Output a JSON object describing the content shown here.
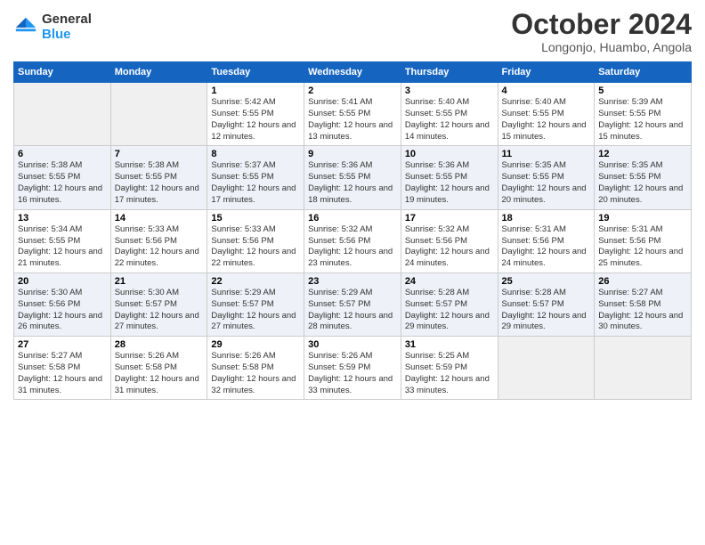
{
  "logo": {
    "general": "General",
    "blue": "Blue"
  },
  "title": "October 2024",
  "subtitle": "Longonjo, Huambo, Angola",
  "weekdays": [
    "Sunday",
    "Monday",
    "Tuesday",
    "Wednesday",
    "Thursday",
    "Friday",
    "Saturday"
  ],
  "weeks": [
    [
      {
        "day": "",
        "sunrise": "",
        "sunset": "",
        "daylight": ""
      },
      {
        "day": "",
        "sunrise": "",
        "sunset": "",
        "daylight": ""
      },
      {
        "day": "1",
        "sunrise": "Sunrise: 5:42 AM",
        "sunset": "Sunset: 5:55 PM",
        "daylight": "Daylight: 12 hours and 12 minutes."
      },
      {
        "day": "2",
        "sunrise": "Sunrise: 5:41 AM",
        "sunset": "Sunset: 5:55 PM",
        "daylight": "Daylight: 12 hours and 13 minutes."
      },
      {
        "day": "3",
        "sunrise": "Sunrise: 5:40 AM",
        "sunset": "Sunset: 5:55 PM",
        "daylight": "Daylight: 12 hours and 14 minutes."
      },
      {
        "day": "4",
        "sunrise": "Sunrise: 5:40 AM",
        "sunset": "Sunset: 5:55 PM",
        "daylight": "Daylight: 12 hours and 15 minutes."
      },
      {
        "day": "5",
        "sunrise": "Sunrise: 5:39 AM",
        "sunset": "Sunset: 5:55 PM",
        "daylight": "Daylight: 12 hours and 15 minutes."
      }
    ],
    [
      {
        "day": "6",
        "sunrise": "Sunrise: 5:38 AM",
        "sunset": "Sunset: 5:55 PM",
        "daylight": "Daylight: 12 hours and 16 minutes."
      },
      {
        "day": "7",
        "sunrise": "Sunrise: 5:38 AM",
        "sunset": "Sunset: 5:55 PM",
        "daylight": "Daylight: 12 hours and 17 minutes."
      },
      {
        "day": "8",
        "sunrise": "Sunrise: 5:37 AM",
        "sunset": "Sunset: 5:55 PM",
        "daylight": "Daylight: 12 hours and 17 minutes."
      },
      {
        "day": "9",
        "sunrise": "Sunrise: 5:36 AM",
        "sunset": "Sunset: 5:55 PM",
        "daylight": "Daylight: 12 hours and 18 minutes."
      },
      {
        "day": "10",
        "sunrise": "Sunrise: 5:36 AM",
        "sunset": "Sunset: 5:55 PM",
        "daylight": "Daylight: 12 hours and 19 minutes."
      },
      {
        "day": "11",
        "sunrise": "Sunrise: 5:35 AM",
        "sunset": "Sunset: 5:55 PM",
        "daylight": "Daylight: 12 hours and 20 minutes."
      },
      {
        "day": "12",
        "sunrise": "Sunrise: 5:35 AM",
        "sunset": "Sunset: 5:55 PM",
        "daylight": "Daylight: 12 hours and 20 minutes."
      }
    ],
    [
      {
        "day": "13",
        "sunrise": "Sunrise: 5:34 AM",
        "sunset": "Sunset: 5:55 PM",
        "daylight": "Daylight: 12 hours and 21 minutes."
      },
      {
        "day": "14",
        "sunrise": "Sunrise: 5:33 AM",
        "sunset": "Sunset: 5:56 PM",
        "daylight": "Daylight: 12 hours and 22 minutes."
      },
      {
        "day": "15",
        "sunrise": "Sunrise: 5:33 AM",
        "sunset": "Sunset: 5:56 PM",
        "daylight": "Daylight: 12 hours and 22 minutes."
      },
      {
        "day": "16",
        "sunrise": "Sunrise: 5:32 AM",
        "sunset": "Sunset: 5:56 PM",
        "daylight": "Daylight: 12 hours and 23 minutes."
      },
      {
        "day": "17",
        "sunrise": "Sunrise: 5:32 AM",
        "sunset": "Sunset: 5:56 PM",
        "daylight": "Daylight: 12 hours and 24 minutes."
      },
      {
        "day": "18",
        "sunrise": "Sunrise: 5:31 AM",
        "sunset": "Sunset: 5:56 PM",
        "daylight": "Daylight: 12 hours and 24 minutes."
      },
      {
        "day": "19",
        "sunrise": "Sunrise: 5:31 AM",
        "sunset": "Sunset: 5:56 PM",
        "daylight": "Daylight: 12 hours and 25 minutes."
      }
    ],
    [
      {
        "day": "20",
        "sunrise": "Sunrise: 5:30 AM",
        "sunset": "Sunset: 5:56 PM",
        "daylight": "Daylight: 12 hours and 26 minutes."
      },
      {
        "day": "21",
        "sunrise": "Sunrise: 5:30 AM",
        "sunset": "Sunset: 5:57 PM",
        "daylight": "Daylight: 12 hours and 27 minutes."
      },
      {
        "day": "22",
        "sunrise": "Sunrise: 5:29 AM",
        "sunset": "Sunset: 5:57 PM",
        "daylight": "Daylight: 12 hours and 27 minutes."
      },
      {
        "day": "23",
        "sunrise": "Sunrise: 5:29 AM",
        "sunset": "Sunset: 5:57 PM",
        "daylight": "Daylight: 12 hours and 28 minutes."
      },
      {
        "day": "24",
        "sunrise": "Sunrise: 5:28 AM",
        "sunset": "Sunset: 5:57 PM",
        "daylight": "Daylight: 12 hours and 29 minutes."
      },
      {
        "day": "25",
        "sunrise": "Sunrise: 5:28 AM",
        "sunset": "Sunset: 5:57 PM",
        "daylight": "Daylight: 12 hours and 29 minutes."
      },
      {
        "day": "26",
        "sunrise": "Sunrise: 5:27 AM",
        "sunset": "Sunset: 5:58 PM",
        "daylight": "Daylight: 12 hours and 30 minutes."
      }
    ],
    [
      {
        "day": "27",
        "sunrise": "Sunrise: 5:27 AM",
        "sunset": "Sunset: 5:58 PM",
        "daylight": "Daylight: 12 hours and 31 minutes."
      },
      {
        "day": "28",
        "sunrise": "Sunrise: 5:26 AM",
        "sunset": "Sunset: 5:58 PM",
        "daylight": "Daylight: 12 hours and 31 minutes."
      },
      {
        "day": "29",
        "sunrise": "Sunrise: 5:26 AM",
        "sunset": "Sunset: 5:58 PM",
        "daylight": "Daylight: 12 hours and 32 minutes."
      },
      {
        "day": "30",
        "sunrise": "Sunrise: 5:26 AM",
        "sunset": "Sunset: 5:59 PM",
        "daylight": "Daylight: 12 hours and 33 minutes."
      },
      {
        "day": "31",
        "sunrise": "Sunrise: 5:25 AM",
        "sunset": "Sunset: 5:59 PM",
        "daylight": "Daylight: 12 hours and 33 minutes."
      },
      {
        "day": "",
        "sunrise": "",
        "sunset": "",
        "daylight": ""
      },
      {
        "day": "",
        "sunrise": "",
        "sunset": "",
        "daylight": ""
      }
    ]
  ]
}
